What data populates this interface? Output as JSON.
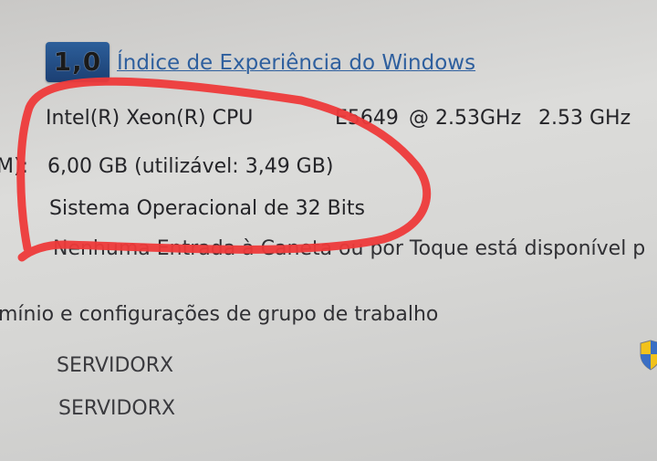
{
  "header": {
    "score": "1,0",
    "title": "Índice de Experiência do Windows"
  },
  "system": {
    "processor_label": "Intel(R) Xeon(R) CPU",
    "processor_model": "E5649",
    "processor_speed": "@ 2.53GHz",
    "processor_speed2": "2.53 GHz",
    "ram_label_fragment": "M):",
    "ram_value": "6,00 GB (utilizável: 3,49 GB)",
    "os_type": "Sistema Operacional de 32 Bits",
    "pen_touch": "Nenhuma Entrada à Caneta ou por Toque está disponível p"
  },
  "domain_section": {
    "title": "mínio e configurações de grupo de trabalho",
    "values": [
      "SERVIDORX",
      "SERVIDORX"
    ]
  },
  "icons": {
    "score_badge": "windows-experience-index-badge",
    "change_settings": "uac-shield-icon"
  },
  "colors": {
    "link": "#2e5f9e",
    "annotation": "#ee3a3a",
    "badge": "#1b3f73"
  }
}
